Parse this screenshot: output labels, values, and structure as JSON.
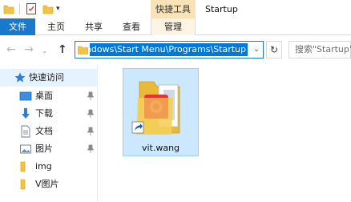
{
  "window": {
    "title": "Startup",
    "context_tab_header": "快捷工具"
  },
  "quick_access_toolbar": {
    "icons": [
      "folder-icon",
      "properties-icon",
      "new-folder-icon",
      "customize-dropdown-icon"
    ]
  },
  "ribbon": {
    "tabs": [
      {
        "label": "文件",
        "active": true
      },
      {
        "label": "主页"
      },
      {
        "label": "共享"
      },
      {
        "label": "查看"
      },
      {
        "label": "管理"
      }
    ]
  },
  "address_bar": {
    "path_visible": "indows\\Start Menu\\Programs\\Startup",
    "search_placeholder": "搜索\"Startup\""
  },
  "sidebar": {
    "items": [
      {
        "label": "快速访问",
        "icon": "star-icon",
        "pinned": false
      },
      {
        "label": "桌面",
        "icon": "desktop-icon",
        "pinned": true
      },
      {
        "label": "下载",
        "icon": "download-icon",
        "pinned": true
      },
      {
        "label": "文档",
        "icon": "document-icon",
        "pinned": true
      },
      {
        "label": "图片",
        "icon": "pictures-icon",
        "pinned": true
      },
      {
        "label": "img",
        "icon": "folder-icon",
        "pinned": false
      },
      {
        "label": "V图片",
        "icon": "folder-icon",
        "pinned": false
      }
    ]
  },
  "content": {
    "files": [
      {
        "name": "vit.wang",
        "icon": "shortcut-icon",
        "selected": true
      }
    ]
  },
  "colors": {
    "accent": "#1979ca",
    "selection": "#cce8ff",
    "context_tab": "#f8e3b9"
  }
}
